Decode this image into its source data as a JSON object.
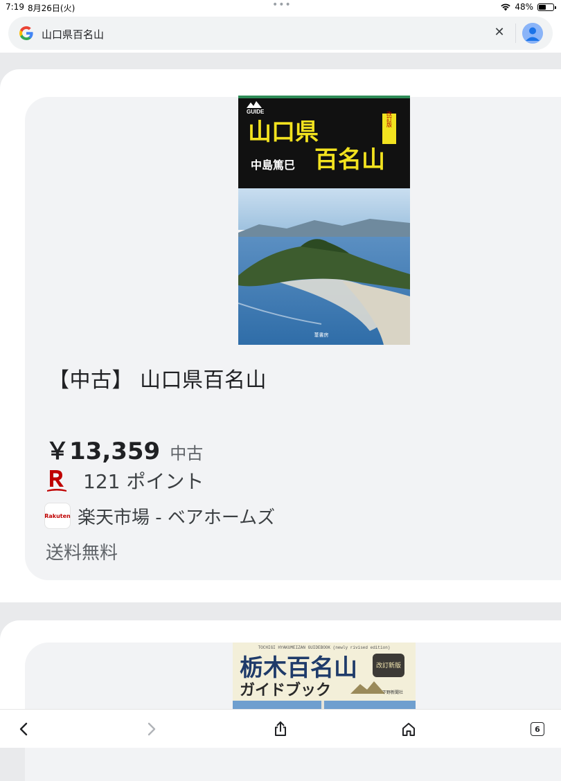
{
  "status": {
    "time": "7:19",
    "date": "8月26日(火)",
    "battery": "48%",
    "battery_level": 0.48
  },
  "search": {
    "query": "山口県百名山"
  },
  "product": {
    "cover_title": "山口県百名山",
    "cover_line1": "山口県",
    "cover_line2": "百名山",
    "cover_author": "中島篤巳",
    "cover_badge": "改訂版",
    "cover_series": "GUIDE",
    "cover_publisher": "葦書房",
    "title": "【中古】 山口県百名山",
    "price": "￥13,359",
    "condition": "中古",
    "points": "121 ポイント",
    "seller": "楽天市場 - ベアホームズ",
    "seller_logo_text": "Rakuten",
    "shipping": "送料無料"
  },
  "next_product": {
    "cover_subtitle": "TOCHIGI HYAKUMEIZAN GUIDEBOOK (newly rivised edition)",
    "cover_title": "栃木百名山",
    "cover_line2": "ガイドブック",
    "cover_badge": "改訂新版",
    "cover_publisher": "下野新聞社"
  },
  "toolbar": {
    "tab_count": "6"
  },
  "colors": {
    "accent_red": "#bf0000",
    "cover_yellow": "#f2e21f",
    "cover_black": "#111111"
  }
}
